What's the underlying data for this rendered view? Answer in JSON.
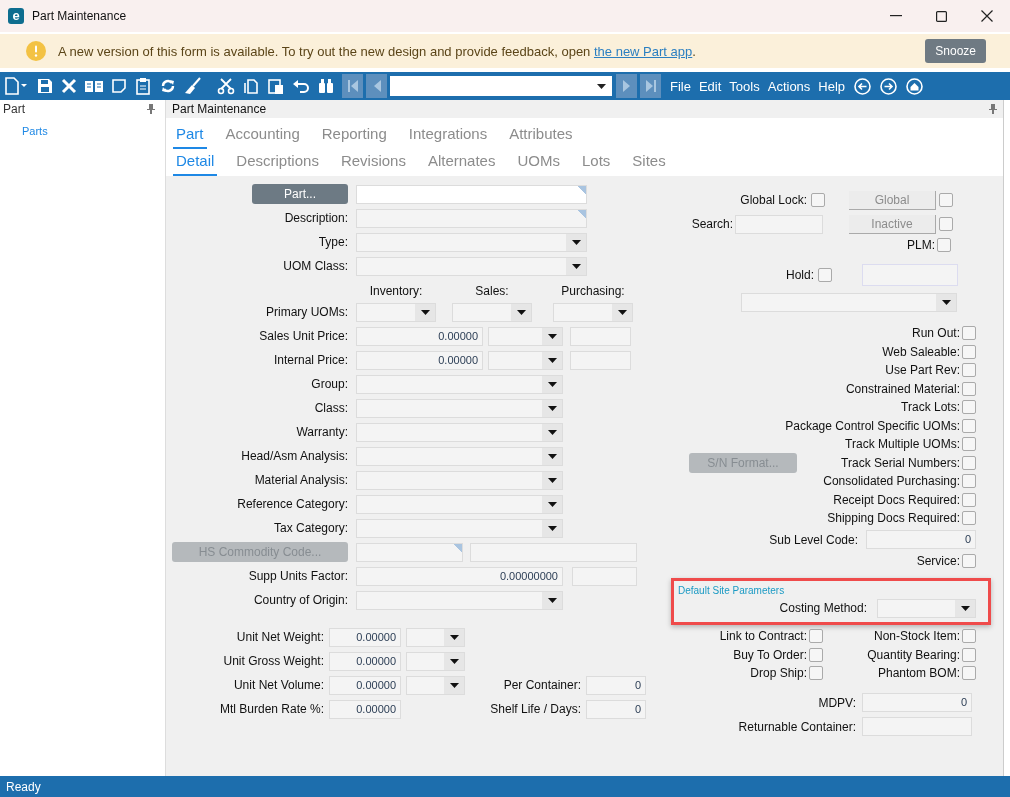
{
  "window": {
    "title": "Part Maintenance",
    "logo": "e"
  },
  "banner": {
    "text": "A new version of this form is available. To try out the new design and provide feedback, open ",
    "link": "the new Part app",
    "end": ".",
    "button": "Snooze"
  },
  "toolbar": {
    "menus": [
      "File",
      "Edit",
      "Tools",
      "Actions",
      "Help"
    ]
  },
  "sidebar": {
    "title": "Part",
    "items": [
      "Parts"
    ]
  },
  "panel": {
    "title": "Part Maintenance"
  },
  "tabs": [
    {
      "label": "Part",
      "selected": true
    },
    {
      "label": "Accounting",
      "selected": false
    },
    {
      "label": "Reporting",
      "selected": false
    },
    {
      "label": "Integrations",
      "selected": false
    },
    {
      "label": "Attributes",
      "selected": false
    }
  ],
  "subtabs": [
    {
      "label": "Detail",
      "selected": true
    },
    {
      "label": "Descriptions",
      "selected": false
    },
    {
      "label": "Revisions",
      "selected": false
    },
    {
      "label": "Alternates",
      "selected": false
    },
    {
      "label": "UOMs",
      "selected": false
    },
    {
      "label": "Lots",
      "selected": false
    },
    {
      "label": "Sites",
      "selected": false
    }
  ],
  "left_fields": [
    {
      "kind": "part_lookup",
      "button": "Part...",
      "disabled": false
    },
    {
      "kind": "note",
      "label": "Description:"
    },
    {
      "kind": "combo_long",
      "label": "Type:"
    },
    {
      "kind": "combo_long",
      "label": "UOM Class:"
    },
    {
      "kind": "headers",
      "columns": [
        "Inventory:",
        "Sales:",
        "Purchasing:"
      ]
    },
    {
      "kind": "uom_combos",
      "label": "Primary UOMs:"
    },
    {
      "kind": "price",
      "label": "Sales Unit Price:",
      "value": "0.00000"
    },
    {
      "kind": "price",
      "label": "Internal Price:",
      "value": "0.00000"
    },
    {
      "kind": "combo",
      "label": "Group:"
    },
    {
      "kind": "combo",
      "label": "Class:"
    },
    {
      "kind": "combo",
      "label": "Warranty:"
    },
    {
      "kind": "combo",
      "label": "Head/Asm Analysis:"
    },
    {
      "kind": "combo",
      "label": "Material Analysis:"
    },
    {
      "kind": "combo",
      "label": "Reference Category:"
    },
    {
      "kind": "combo",
      "label": "Tax Category:"
    },
    {
      "kind": "hs_lookup",
      "button": "HS Commodity Code...",
      "disabled": true
    },
    {
      "kind": "factor",
      "label": "Supp Units Factor:",
      "value": "0.00000000"
    },
    {
      "kind": "combo",
      "label": "Country of Origin:"
    }
  ],
  "measures": [
    {
      "label": "Unit Net Weight:",
      "value": "0.00000",
      "has_uom": true
    },
    {
      "label": "Unit Gross Weight:",
      "value": "0.00000",
      "has_uom": true
    },
    {
      "label": "Unit Net Volume:",
      "value": "0.00000",
      "has_uom": true,
      "extra": {
        "label": "Per Container:",
        "value": "0"
      }
    },
    {
      "label": "Mtl Burden Rate %:",
      "value": "0.00000",
      "has_uom": false,
      "extra": {
        "label": "Shelf Life / Days:",
        "value": "0"
      }
    }
  ],
  "global_lock": {
    "label": "Global Lock:",
    "checked": false
  },
  "global_button": {
    "label": "Global",
    "disabled": true,
    "checked": false
  },
  "search": {
    "label": "Search:"
  },
  "inactive_button": {
    "label": "Inactive",
    "disabled": true,
    "checked": false
  },
  "plm": {
    "label": "PLM:",
    "checked": false
  },
  "hold": {
    "label": "Hold:",
    "checked": false
  },
  "flags": [
    {
      "label": "Run Out:",
      "checked": false
    },
    {
      "label": "Web Saleable:",
      "checked": false
    },
    {
      "label": "Use Part Rev:",
      "checked": false
    },
    {
      "label": "Constrained Material:",
      "checked": false
    },
    {
      "label": "Track Lots:",
      "checked": false
    },
    {
      "label": "Package Control Specific UOMs:",
      "checked": false
    },
    {
      "label": "Track Multiple UOMs:",
      "checked": false
    },
    {
      "label": "Track Serial Numbers:",
      "checked": false,
      "button": {
        "label": "S/N Format...",
        "disabled": true
      }
    },
    {
      "label": "Consolidated Purchasing:",
      "checked": false
    },
    {
      "label": "Receipt Docs Required:",
      "checked": false
    },
    {
      "label": "Shipping Docs Required:",
      "checked": false
    }
  ],
  "sub_level_code": {
    "label": "Sub Level Code:",
    "value": "0"
  },
  "service": {
    "label": "Service:",
    "checked": false
  },
  "site_parameters": {
    "title": "Default Site Parameters",
    "highlighted": true,
    "costing_method": "Costing Method:",
    "flags": [
      {
        "label": "Link to Contract:",
        "checked": false
      },
      {
        "label": "Non-Stock Item:",
        "checked": false
      },
      {
        "label": "Buy To Order:",
        "checked": false
      },
      {
        "label": "Quantity Bearing:",
        "checked": false
      },
      {
        "label": "Drop Ship:",
        "checked": false
      },
      {
        "label": "Phantom BOM:",
        "checked": false
      }
    ]
  },
  "mdpv": {
    "label": "MDPV:",
    "value": "0"
  },
  "returnable_container": {
    "label": "Returnable Container:"
  },
  "status_bar": {
    "text": "Ready"
  }
}
